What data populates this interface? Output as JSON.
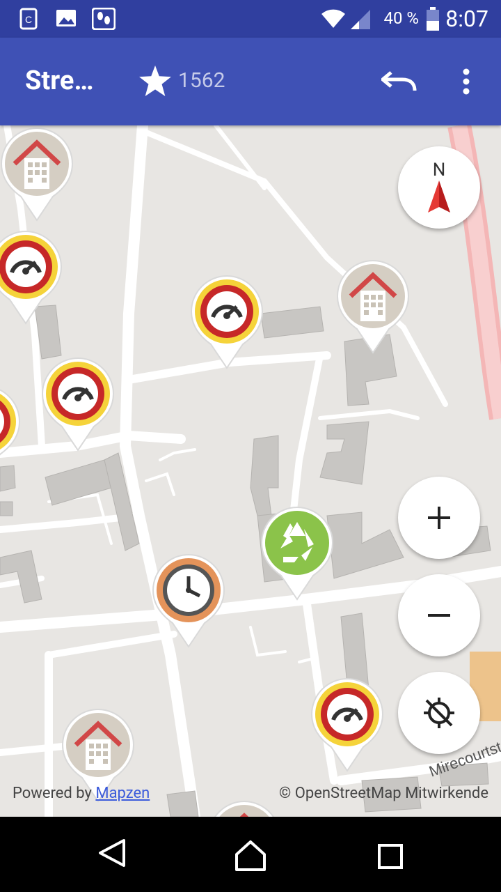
{
  "status_bar": {
    "battery_percent": "40 %",
    "time": "8:07",
    "icons": [
      "notification-c-icon",
      "image-icon",
      "footsteps-icon",
      "wifi-icon",
      "signal-icon",
      "battery-icon"
    ]
  },
  "app_bar": {
    "title": "Stre…",
    "star_count": "1562",
    "icons": [
      "star-icon",
      "undo-icon",
      "more-vert-icon"
    ],
    "color": "#3f51b5"
  },
  "map": {
    "compass_label": "N",
    "street_label": "Mirecourtst",
    "attribution_prefix": "Powered by ",
    "attribution_link": "Mapzen",
    "attribution_osm": "© OpenStreetMap Mitwirkende",
    "controls": [
      "zoom-in-icon",
      "zoom-out-icon",
      "gps-location-icon"
    ],
    "quest_pins": [
      "building-icon",
      "speed-limit-icon",
      "recycling-icon",
      "opening-hours-icon"
    ]
  },
  "nav_bar": {
    "icons": [
      "back-icon",
      "home-icon",
      "recents-icon"
    ]
  }
}
